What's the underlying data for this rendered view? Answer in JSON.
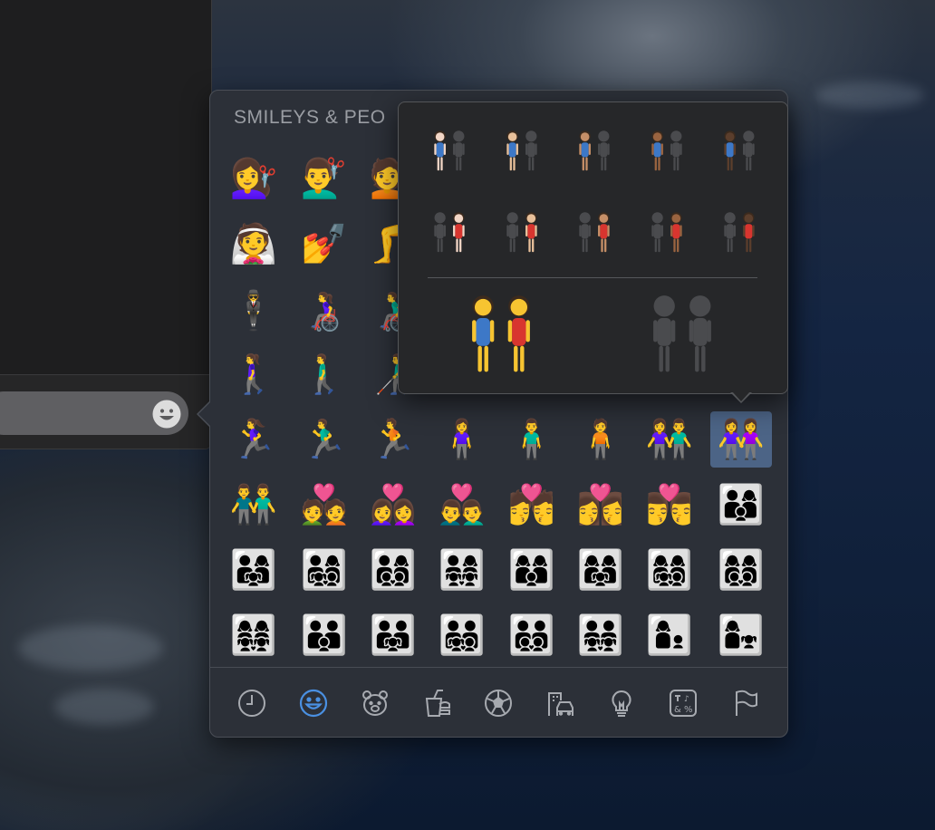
{
  "picker": {
    "section_title": "SMILEYS & PEO",
    "selected_emoji": "👭"
  },
  "grid_rows": [
    [
      "💇‍♀️",
      "💇‍♂️",
      "💇"
    ],
    [
      "👰",
      "💅",
      "🦵"
    ],
    [
      "🕴",
      "👩‍🦽",
      "👨‍🦽"
    ],
    [
      "🚶‍♀️",
      "🚶‍♂️",
      "👨‍🦯"
    ],
    [
      "🏃‍♀️",
      "🏃‍♂️",
      "🏃",
      "🧍‍♀️",
      "🧍‍♂️",
      "🧍",
      "👫",
      "👭"
    ],
    [
      "👬",
      "💑",
      "👩‍❤️‍👩",
      "👨‍❤️‍👨",
      "💏",
      "👩‍❤️‍💋‍👩",
      "👨‍❤️‍💋‍👨",
      "👨‍👩‍👦"
    ],
    [
      "👨‍👩‍👧",
      "👨‍👩‍👧‍👦",
      "👨‍👩‍👦‍👦",
      "👨‍👩‍👧‍👧",
      "👩‍👩‍👦",
      "👩‍👩‍👧",
      "👩‍👩‍👧‍👦",
      "👩‍👩‍👦‍👦"
    ],
    [
      "👩‍👩‍👧‍👧",
      "👨‍👨‍👦",
      "👨‍👨‍👧",
      "👨‍👨‍👧‍👦",
      "👨‍👨‍👦‍👦",
      "👨‍👨‍👧‍👧",
      "👩‍👦",
      "👩‍👧"
    ]
  ],
  "skin_tone_popover": {
    "tones": [
      "#F2D6C6",
      "#E8C09A",
      "#C68F67",
      "#9A6440",
      "#5B3E2C"
    ],
    "shadow_color": "#4a4b4e",
    "left_outfit": "#3d78c7",
    "right_outfit": "#d8352f",
    "default_skin": "#F7C431"
  },
  "categories": [
    {
      "name": "frequently-used",
      "icon": "clock-icon"
    },
    {
      "name": "smileys-people",
      "icon": "smiley-icon",
      "active": true
    },
    {
      "name": "animals-nature",
      "icon": "bear-icon"
    },
    {
      "name": "food-drink",
      "icon": "food-icon"
    },
    {
      "name": "activity",
      "icon": "soccer-ball-icon"
    },
    {
      "name": "travel-places",
      "icon": "building-icon"
    },
    {
      "name": "objects",
      "icon": "lightbulb-icon"
    },
    {
      "name": "symbols",
      "icon": "symbols-icon"
    },
    {
      "name": "flags",
      "icon": "flag-icon"
    }
  ],
  "colors": {
    "accent": "#4a90e2",
    "category_icon": "#a7aab0",
    "selection": "#4c6486"
  }
}
